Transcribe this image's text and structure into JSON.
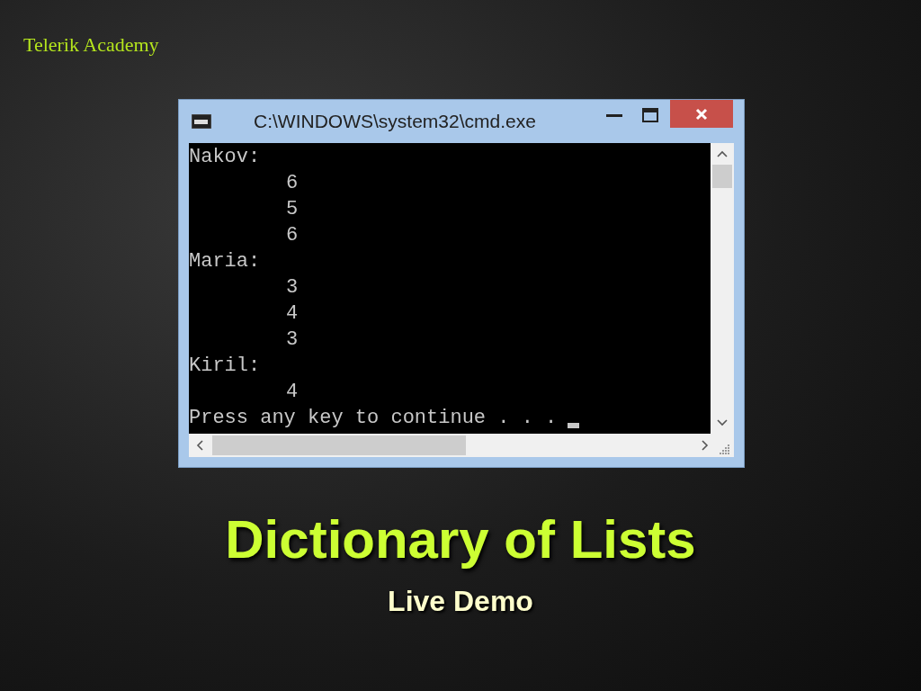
{
  "logo": {
    "text": "Telerik Academy"
  },
  "window": {
    "title": "C:\\WINDOWS\\system32\\cmd.exe",
    "lines": [
      {
        "text": "Nakov:",
        "indented": false
      },
      {
        "text": "6",
        "indented": true
      },
      {
        "text": "5",
        "indented": true
      },
      {
        "text": "6",
        "indented": true
      },
      {
        "text": "Maria:",
        "indented": false
      },
      {
        "text": "3",
        "indented": true
      },
      {
        "text": "4",
        "indented": true
      },
      {
        "text": "3",
        "indented": true
      },
      {
        "text": "Kiril:",
        "indented": false
      },
      {
        "text": "4",
        "indented": true
      },
      {
        "text": "Press any key to continue . . .",
        "indented": false,
        "cursor": true
      }
    ]
  },
  "slide_title": "Dictionary of Lists",
  "subtitle": "Live Demo"
}
